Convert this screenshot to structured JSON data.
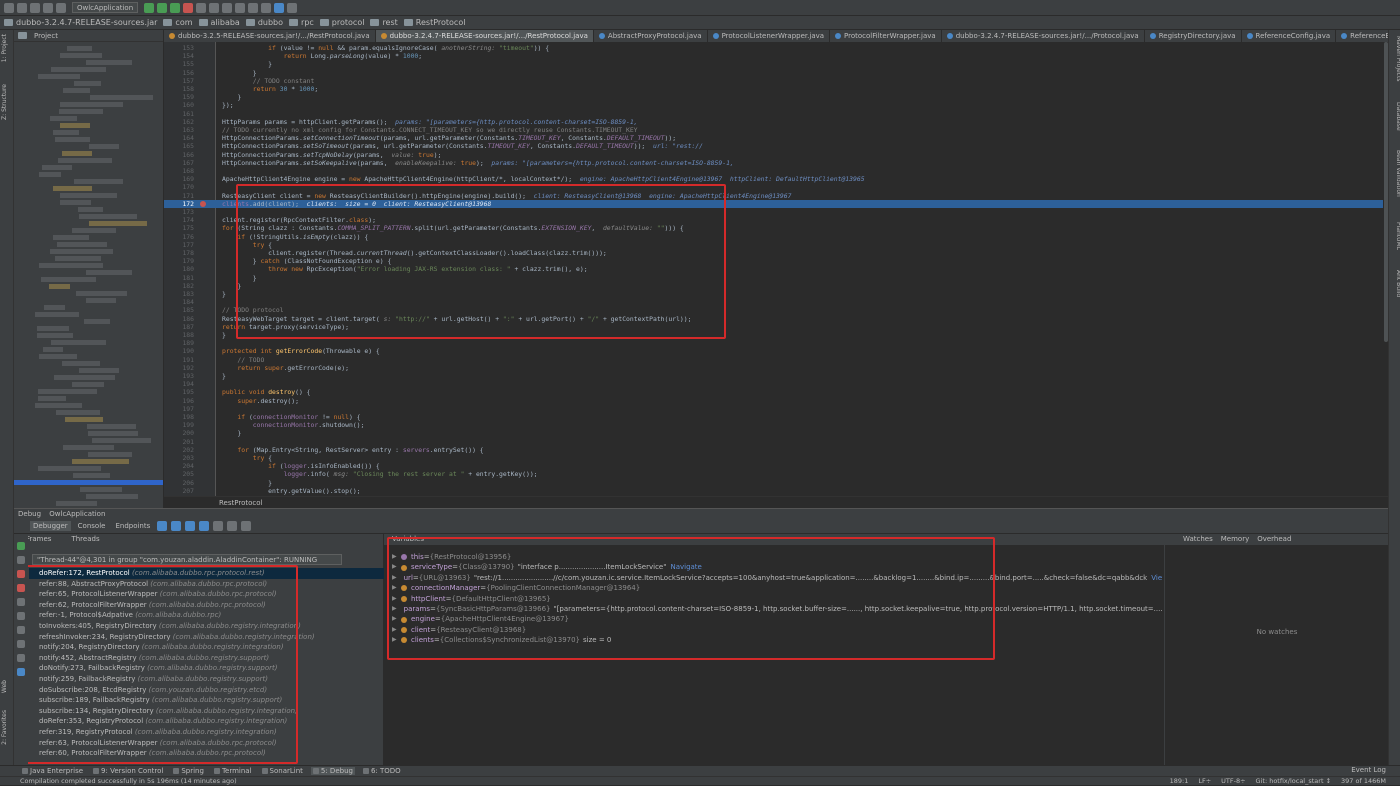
{
  "toolbar": {
    "run_config": "OwlcApplication"
  },
  "breadcrumbs": [
    "dubbo-3.2.4.7-RELEASE-sources.jar",
    "com",
    "alibaba",
    "dubbo",
    "rpc",
    "protocol",
    "rest",
    "RestProtocol"
  ],
  "left_strip": {
    "project": "1: Project",
    "structure": "Z: Structure",
    "web": "Web",
    "favorites": "2: Favorites"
  },
  "right_strip": {
    "maven": "Maven Projects",
    "database": "Database",
    "bean_validation": "Bean Validation",
    "plantuml": "PlantUML",
    "ant": "Ant Build"
  },
  "project_panel": {
    "title": "Project"
  },
  "tabs": [
    {
      "label": "dubbo-3.2.5-RELEASE-sources.jar!/.../RestProtocol.java",
      "active": false
    },
    {
      "label": "dubbo-3.2.4.7-RELEASE-sources.jar!/.../RestProtocol.java",
      "active": true
    },
    {
      "label": "AbstractProxyProtocol.java",
      "active": false
    },
    {
      "label": "ProtocolListenerWrapper.java",
      "active": false
    },
    {
      "label": "ProtocolFilterWrapper.java",
      "active": false
    },
    {
      "label": "dubbo-3.2.4.7-RELEASE-sources.jar!/.../Protocol.java",
      "active": false
    },
    {
      "label": "RegistryDirectory.java",
      "active": false
    },
    {
      "label": "ReferenceConfig.java",
      "active": false
    },
    {
      "label": "ReferenceBean.java",
      "active": false
    }
  ],
  "editor": {
    "footer": "RestProtocol",
    "lines": [
      {
        "n": "153",
        "html": "            <span class=\"k\">if</span> (value != <span class=\"k\">null</span> &amp;&amp; param.equalsIgnoreCase( <span class=\"hint2\">anotherString:</span> <span class=\"s\">\"timeout\"</span>)) {"
      },
      {
        "n": "154",
        "html": "                <span class=\"k\">return</span> Long.<span class=\"i\">parseLong</span>(value) * <span class=\"n\">1000</span>;"
      },
      {
        "n": "155",
        "html": "            }"
      },
      {
        "n": "156",
        "html": "        }"
      },
      {
        "n": "157",
        "html": "        <span class=\"c\">// TODO constant</span>"
      },
      {
        "n": "158",
        "html": "        <span class=\"k\">return</span> <span class=\"n\">30</span> * <span class=\"n\">1000</span>;"
      },
      {
        "n": "159",
        "html": "    }"
      },
      {
        "n": "160",
        "html": "});"
      },
      {
        "n": "161",
        "html": ""
      },
      {
        "n": "162",
        "html": "HttpParams params = httpClient.getParams();  <span class=\"hint\">params: \"[parameters={http.protocol.content-charset=ISO-8859-1,</span>"
      },
      {
        "n": "163",
        "html": "<span class=\"c\">// TODO currently no xml config for Constants.CONNECT_TIMEOUT_KEY so we directly reuse Constants.TIMEOUT_KEY</span>"
      },
      {
        "n": "164",
        "html": "HttpConnectionParams.<span class=\"i\">setConnectionTimeout</span>(params, url.getParameter(Constants.<span class=\"f i\">TIMEOUT_KEY</span>, Constants.<span class=\"f i\">DEFAULT_TIMEOUT</span>));"
      },
      {
        "n": "165",
        "html": "HttpConnectionParams.<span class=\"i\">setSoTimeout</span>(params, url.getParameter(Constants.<span class=\"f i\">TIMEOUT_KEY</span>, Constants.<span class=\"f i\">DEFAULT_TIMEOUT</span>));  <span class=\"hint\">url: \"rest://</span>"
      },
      {
        "n": "166",
        "html": "HttpConnectionParams.<span class=\"i\">setTcpNoDelay</span>(params,  <span class=\"hint2\">value:</span> <span class=\"k\">true</span>);"
      },
      {
        "n": "167",
        "html": "HttpConnectionParams.<span class=\"i\">setSoKeepalive</span>(params,  <span class=\"hint2\">enableKeepalive:</span> <span class=\"k\">true</span>);  <span class=\"hint\">params: \"[parameters={http.protocol.content-charset=ISO-8859-1,</span>"
      },
      {
        "n": "168",
        "html": ""
      },
      {
        "n": "169",
        "html": "ApacheHttpClient4Engine engine = <span class=\"k\">new</span> ApacheHttpClient4Engine(httpClient/*, localContext*/);  <span class=\"hint\">engine: ApacheHttpClient4Engine@13967  httpClient: DefaultHttpClient@13965</span>"
      },
      {
        "n": "170",
        "html": ""
      },
      {
        "n": "171",
        "html": "ResteasyClient client = <span class=\"k\">new</span> ResteasyClientBuilder().httpEngine(engine).build();  <span class=\"hint\">client: ResteasyClient@13968  engine: ApacheHttpClient4Engine@13967</span>"
      },
      {
        "n": "172",
        "html": "<span class=\"f\">clients</span>.add(client);  <span class=\"hint\" style=\"color:#dfe8f5\">clients:  size = 0  client: ResteasyClient@13968</span>",
        "exec": true,
        "bp": true
      },
      {
        "n": "173",
        "html": ""
      },
      {
        "n": "174",
        "html": "client.register(RpcContextFilter.<span class=\"k\">class</span>);"
      },
      {
        "n": "175",
        "html": "<span class=\"k\">for</span> (String clazz : Constants.<span class=\"f i\">COMMA_SPLIT_PATTERN</span>.split(url.getParameter(Constants.<span class=\"f i\">EXTENSION_KEY</span>,  <span class=\"hint2\">defaultValue:</span> <span class=\"s\">\"\"</span>))) {"
      },
      {
        "n": "176",
        "html": "    <span class=\"k\">if</span> (!StringUtils.<span class=\"i\">isEmpty</span>(clazz)) {"
      },
      {
        "n": "177",
        "html": "        <span class=\"k\">try</span> {"
      },
      {
        "n": "178",
        "html": "            client.register(Thread.<span class=\"i\">currentThread</span>().getContextClassLoader().loadClass(clazz.trim()));"
      },
      {
        "n": "179",
        "html": "        } <span class=\"k\">catch</span> (ClassNotFoundException e) {"
      },
      {
        "n": "180",
        "html": "            <span class=\"k\">throw new</span> RpcException(<span class=\"s\">\"Error loading JAX-RS extension class: \"</span> + clazz.trim(), e);"
      },
      {
        "n": "181",
        "html": "        }"
      },
      {
        "n": "182",
        "html": "    }"
      },
      {
        "n": "183",
        "html": "}"
      },
      {
        "n": "184",
        "html": ""
      },
      {
        "n": "185",
        "html": "<span class=\"c\">// TODO protocol</span>"
      },
      {
        "n": "186",
        "html": "ResteasyWebTarget target = client.target( <span class=\"hint2\">s:</span> <span class=\"s\">\"http://\"</span> + url.getHost() + <span class=\"s\">\":\"</span> + url.getPort() + <span class=\"s\">\"/\"</span> + getContextPath(url));"
      },
      {
        "n": "187",
        "html": "<span class=\"k\">return</span> target.proxy(serviceType);"
      },
      {
        "n": "188",
        "html": "}"
      },
      {
        "n": "189",
        "html": ""
      },
      {
        "n": "190",
        "html": "<span class=\"k\">protected int</span> <span style=\"color:#ffc66d\">getErrorCode</span>(Throwable e) {"
      },
      {
        "n": "191",
        "html": "    <span class=\"c\">// TODO</span>"
      },
      {
        "n": "192",
        "html": "    <span class=\"k\">return super</span>.getErrorCode(e);"
      },
      {
        "n": "193",
        "html": "}"
      },
      {
        "n": "194",
        "html": ""
      },
      {
        "n": "195",
        "html": "<span class=\"k\">public void</span> <span style=\"color:#ffc66d\">destroy</span>() {"
      },
      {
        "n": "196",
        "html": "    <span class=\"k\">super</span>.destroy();"
      },
      {
        "n": "197",
        "html": ""
      },
      {
        "n": "198",
        "html": "    <span class=\"k\">if</span> (<span class=\"f\">connectionMonitor</span> != <span class=\"k\">null</span>) {"
      },
      {
        "n": "199",
        "html": "        <span class=\"f\">connectionMonitor</span>.shutdown();"
      },
      {
        "n": "200",
        "html": "    }"
      },
      {
        "n": "201",
        "html": ""
      },
      {
        "n": "202",
        "html": "    <span class=\"k\">for</span> (Map.Entry&lt;String, RestServer&gt; entry : <span class=\"f\">servers</span>.entrySet()) {"
      },
      {
        "n": "203",
        "html": "        <span class=\"k\">try</span> {"
      },
      {
        "n": "204",
        "html": "            <span class=\"k\">if</span> (<span class=\"f\">logger</span>.isInfoEnabled()) {"
      },
      {
        "n": "205",
        "html": "                <span class=\"f\">logger</span>.info( <span class=\"hint2\">msg:</span> <span class=\"s\">\"Closing the rest server at \"</span> + entry.getKey());"
      },
      {
        "n": "206",
        "html": "            }"
      },
      {
        "n": "207",
        "html": "            entry.getValue().stop();"
      }
    ]
  },
  "debug": {
    "title": "Debug",
    "config": "OwlcApplication",
    "tabs": [
      "Debugger",
      "Console",
      "Endpoints"
    ],
    "frames_label": "Frames",
    "threads_label": "Threads",
    "thread": "\"Thread-44\"@4,301 in group \"com.youzan.aladdin.AladdinContainer\": RUNNING",
    "frames": [
      {
        "method": "doRefer:172, RestProtocol",
        "pkg": "(com.alibaba.dubbo.rpc.protocol.rest)",
        "selected": true
      },
      {
        "method": "refer:88, AbstractProxyProtocol",
        "pkg": "(com.alibaba.dubbo.rpc.protocol)"
      },
      {
        "method": "refer:65, ProtocolListenerWrapper",
        "pkg": "(com.alibaba.dubbo.rpc.protocol)"
      },
      {
        "method": "refer:62, ProtocolFilterWrapper",
        "pkg": "(com.alibaba.dubbo.rpc.protocol)"
      },
      {
        "method": "refer:-1, Protocol$Adpative",
        "pkg": "(com.alibaba.dubbo.rpc)"
      },
      {
        "method": "toInvokers:405, RegistryDirectory",
        "pkg": "(com.alibaba.dubbo.registry.integration)"
      },
      {
        "method": "refreshInvoker:234, RegistryDirectory",
        "pkg": "(com.alibaba.dubbo.registry.integration)"
      },
      {
        "method": "notify:204, RegistryDirectory",
        "pkg": "(com.alibaba.dubbo.registry.integration)"
      },
      {
        "method": "notify:452, AbstractRegistry",
        "pkg": "(com.alibaba.dubbo.registry.support)"
      },
      {
        "method": "doNotify:273, FailbackRegistry",
        "pkg": "(com.alibaba.dubbo.registry.support)"
      },
      {
        "method": "notify:259, FailbackRegistry",
        "pkg": "(com.alibaba.dubbo.registry.support)"
      },
      {
        "method": "doSubscribe:208, EtcdRegistry",
        "pkg": "(com.youzan.dubbo.registry.etcd)"
      },
      {
        "method": "subscribe:189, FailbackRegistry",
        "pkg": "(com.alibaba.dubbo.registry.support)"
      },
      {
        "method": "subscribe:134, RegistryDirectory",
        "pkg": "(com.alibaba.dubbo.registry.integration)"
      },
      {
        "method": "doRefer:353, RegistryProtocol",
        "pkg": "(com.alibaba.dubbo.registry.integration)"
      },
      {
        "method": "refer:319, RegistryProtocol",
        "pkg": "(com.alibaba.dubbo.registry.integration)"
      },
      {
        "method": "refer:63, ProtocolListenerWrapper",
        "pkg": "(com.alibaba.dubbo.rpc.protocol)"
      },
      {
        "method": "refer:60, ProtocolFilterWrapper",
        "pkg": "(com.alibaba.dubbo.rpc.protocol)"
      }
    ],
    "variables_label": "Variables",
    "variables": [
      {
        "name": "this",
        "type": "{RestProtocol@13956}",
        "value": "",
        "icon": "p"
      },
      {
        "name": "serviceType",
        "type": "{Class@13790}",
        "value": "\"interface p.....................ItemLockService\"",
        "nav": "Navigate"
      },
      {
        "name": "url",
        "type": "{URL@13963}",
        "value": "\"rest://1.......................//c/com.youzan.ic.service.ItemLockService?accepts=100&anyhost=true&application=........&backlog=1........&bind.ip=.........&bind.port=.....&check=false&dc=qabb&dck",
        "nav": "View"
      },
      {
        "name": "connectionManager",
        "type": "{PoolingClientConnectionManager@13964}",
        "value": ""
      },
      {
        "name": "httpClient",
        "type": "{DefaultHttpClient@13965}",
        "value": ""
      },
      {
        "name": "params",
        "type": "{SyncBasicHttpParams@13966}",
        "value": "\"[parameters={http.protocol.content-charset=ISO-8859-1, http.socket.buffer-size=......, http.socket.keepalive=true, http.protocol.version=HTTP/1.1, http.socket.timeout=......",
        "nav": "View"
      },
      {
        "name": "engine",
        "type": "{ApacheHttpClient4Engine@13967}",
        "value": ""
      },
      {
        "name": "client",
        "type": "{ResteasyClient@13968}",
        "value": ""
      },
      {
        "name": "clients",
        "type": "{Collections$SynchronizedList@13970}",
        "value": " size = 0"
      }
    ],
    "watches_label": "Watches",
    "memory_label": "Memory",
    "overhead_label": "Overhead",
    "no_watches": "No watches"
  },
  "bottom_tools": [
    "Java Enterprise",
    "9: Version Control",
    "Spring",
    "Terminal",
    "SonarLint",
    "5: Debug",
    "6: TODO"
  ],
  "event_log": "Event Log",
  "status": {
    "message": "Compilation completed successfully in 5s 196ms (14 minutes ago)",
    "position": "189:1",
    "lf": "LF÷",
    "encoding": "UTF-8÷",
    "git": "Git: hotfix/local_start ↕",
    "memory": "397 of 1466M"
  },
  "colors": {
    "accent_exec_line": "#2d6099",
    "highlight_box": "#d42a2a",
    "background": "#2b2b2b"
  }
}
